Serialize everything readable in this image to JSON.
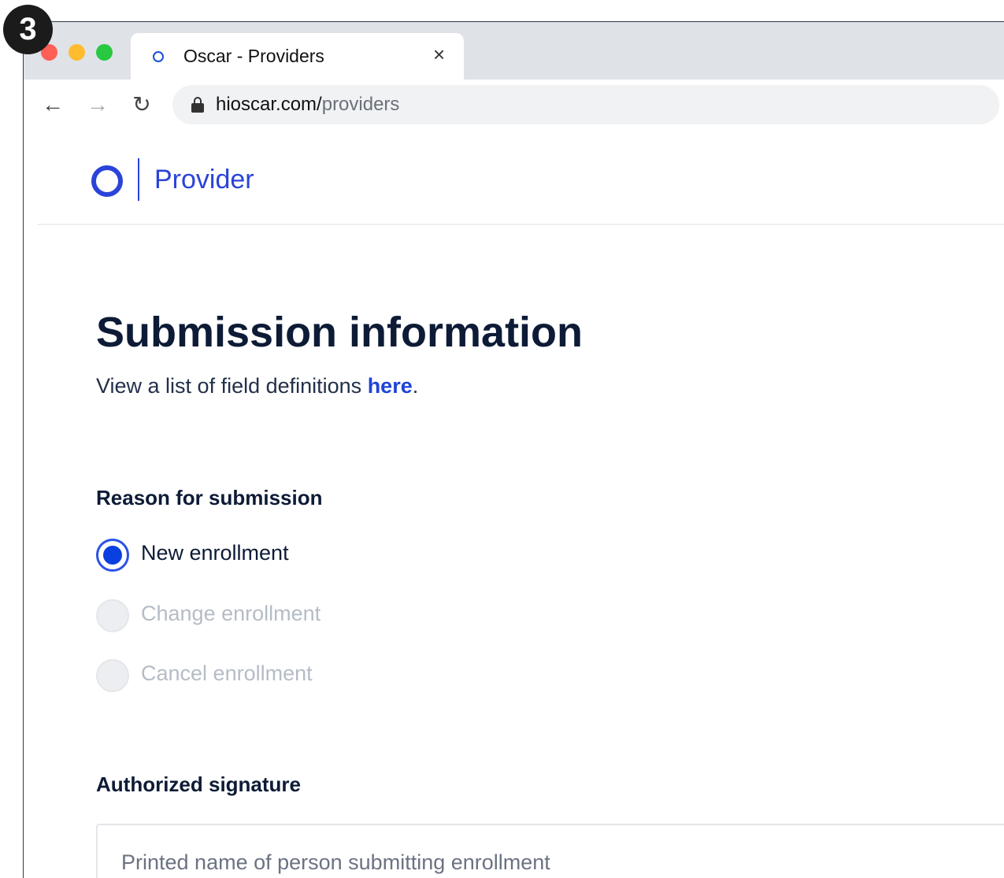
{
  "step_badge": "3",
  "browser": {
    "tab_title": "Oscar - Providers",
    "tab_close": "×",
    "url_host": "hioscar.com/",
    "url_path": "providers",
    "back_glyph": "←",
    "forward_glyph": "→",
    "reload_glyph": "↻"
  },
  "header": {
    "logo_text": "Provider"
  },
  "main": {
    "title": "Submission information",
    "subtitle_prefix": "View a list of field definitions ",
    "subtitle_link": "here",
    "subtitle_suffix": "."
  },
  "reason": {
    "label": "Reason for submission",
    "options": [
      {
        "label": "New enrollment",
        "selected": true
      },
      {
        "label": "Change enrollment",
        "selected": false
      },
      {
        "label": "Cancel enrollment",
        "selected": false
      }
    ]
  },
  "signature": {
    "label": "Authorized signature",
    "placeholder": "Printed name of person submitting enrollment"
  },
  "colors": {
    "brand_blue": "#2a43d8",
    "radio_selected": "#0a3fe0",
    "heading": "#0d1b36"
  }
}
